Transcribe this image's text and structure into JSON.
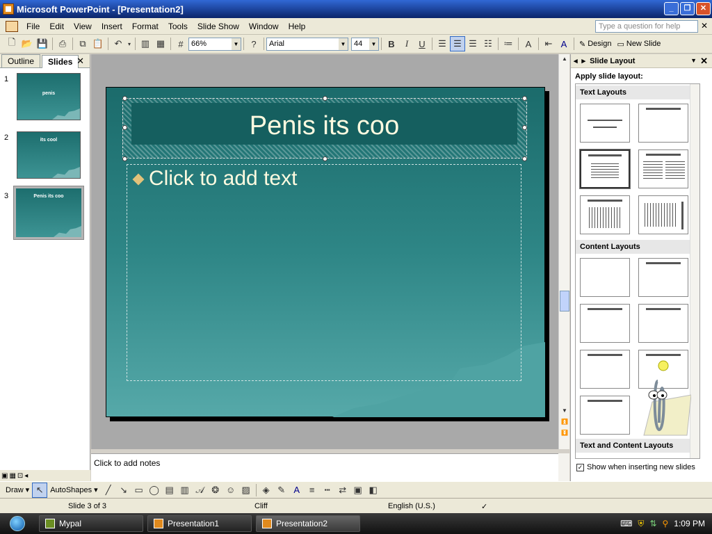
{
  "window": {
    "title": "Microsoft PowerPoint - [Presentation2]"
  },
  "menu": [
    "File",
    "Edit",
    "View",
    "Insert",
    "Format",
    "Tools",
    "Slide Show",
    "Window",
    "Help"
  ],
  "help_placeholder": "Type a question for help",
  "toolbar": {
    "zoom": "66%",
    "font": "Arial",
    "size": "44",
    "design": "Design",
    "new_slide": "New Slide"
  },
  "leftpane": {
    "tabs": [
      "Outline",
      "Slides"
    ],
    "slides": [
      {
        "num": "1",
        "title": "penis"
      },
      {
        "num": "2",
        "title": "its cool"
      },
      {
        "num": "3",
        "title": "Penis its coo"
      }
    ]
  },
  "slide": {
    "title": "Penis its coo",
    "body_placeholder": "Click to add text"
  },
  "notes": {
    "placeholder": "Click to add notes"
  },
  "taskpane": {
    "title": "Slide Layout",
    "apply": "Apply slide layout:",
    "sections": [
      "Text Layouts",
      "Content Layouts",
      "Text and Content Layouts"
    ],
    "show_when": "Show when inserting new slides"
  },
  "drawbar": {
    "draw": "Draw",
    "autoshapes": "AutoShapes"
  },
  "status": {
    "slide": "Slide 3 of 3",
    "design": "Cliff",
    "language": "English (U.S.)"
  },
  "taskbar": {
    "items": [
      "Mypal",
      "Presentation1",
      "Presentation2"
    ],
    "time": "1:09 PM"
  }
}
